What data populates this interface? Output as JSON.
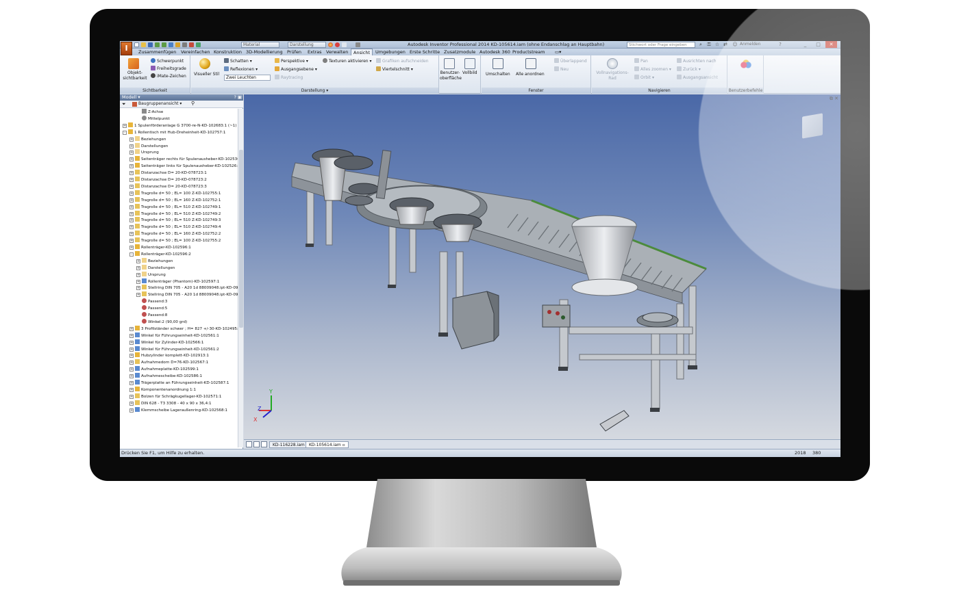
{
  "window": {
    "title": "Autodesk Inventor Professional 2014   KD-105614.iam (ohne Endanschlag an Hauptbahn)",
    "app_letter": "I",
    "search_placeholder": "Stichwort oder Frage eingeben",
    "signin": "Anmelden"
  },
  "quick_access": {
    "material": "Material",
    "appearance": "Darstellung"
  },
  "tabs": [
    "Zusammenfügen",
    "Vereinfachen",
    "Konstruktion",
    "3D-Modellierung",
    "Prüfen",
    "Extras",
    "Verwalten",
    "Ansicht",
    "Umgebungen",
    "Erste Schritte",
    "Zusatzmodule",
    "Autodesk 360",
    "Productstream"
  ],
  "active_tab": "Ansicht",
  "ribbon": {
    "sichtbarkeit": {
      "title": "Sichtbarkeit",
      "big": "Objekt-\nsichtbarkeit",
      "items": [
        "Schwerpunkt",
        "Freiheitsgrade",
        "iMate-Zeichen"
      ]
    },
    "darstellung": {
      "title": "Darstellung",
      "visual_style": "Visueller Stil",
      "items_a": [
        "Schatten",
        "Reflexionen"
      ],
      "lighting": "Zwei Leuchten",
      "items_b": [
        "Perspektive",
        "Ausgangsebene",
        "Raytracing"
      ],
      "items_c": [
        "Texturen aktivieren"
      ],
      "items_d": [
        "Grafiken aufschneiden",
        "Viertelschnitt"
      ]
    },
    "benutzer": {
      "ui": "Benutzer-\noberfläche",
      "full": "Vollbild"
    },
    "fenster": {
      "title": "Fenster",
      "switch": "Umschalten",
      "arrange": "Alle anordnen",
      "items": [
        "Überlappend",
        "Neu"
      ]
    },
    "navigieren": {
      "title": "Navigieren",
      "wheel": "Vollnavigations-\nRad",
      "items_a": [
        "Pan",
        "Alles zoomen",
        "Orbit"
      ],
      "items_b": [
        "Ausrichten nach",
        "Zurück",
        "Ausgangsansicht"
      ]
    },
    "benutzerbefehle": {
      "title": "Benutzerbefehle"
    }
  },
  "browser": {
    "title": "Modell",
    "view": "Baugruppenansicht",
    "rows": [
      {
        "i": 2,
        "t": "Z-Achse",
        "ic": "axis"
      },
      {
        "i": 2,
        "t": "Mittelpunkt",
        "ic": "point"
      },
      {
        "i": 0,
        "t": "1 Spulenförderanlage G 3700-re-N-KD-102683:1 (~1)",
        "ic": "asm",
        "x": "+"
      },
      {
        "i": 0,
        "t": "1 Rollentisch mit Hub-Dreheinheit-KD-102757:1",
        "ic": "asm",
        "x": "-"
      },
      {
        "i": 1,
        "t": "Beziehungen",
        "ic": "folder",
        "x": "+"
      },
      {
        "i": 1,
        "t": "Darstellungen",
        "ic": "folder",
        "x": "+"
      },
      {
        "i": 1,
        "t": "Ursprung",
        "ic": "folder",
        "x": "+"
      },
      {
        "i": 1,
        "t": "Seitenträger rechts für Spulenausheber-KD-102530",
        "ic": "asm",
        "x": "+"
      },
      {
        "i": 1,
        "t": "Seitenträger links für Spulenausheber-KD-102526:1",
        "ic": "asm",
        "x": "+"
      },
      {
        "i": 1,
        "t": "Distanzachse D= 20-KD-078723:1",
        "ic": "part",
        "x": "+"
      },
      {
        "i": 1,
        "t": "Distanzachse D= 20-KD-078723:2",
        "ic": "part",
        "x": "+"
      },
      {
        "i": 1,
        "t": "Distanzachse D= 20-KD-078723:3",
        "ic": "part",
        "x": "+"
      },
      {
        "i": 1,
        "t": "Tragrolle d= 50 ; EL= 100      Z-KD-102755:1",
        "ic": "part",
        "x": "+"
      },
      {
        "i": 1,
        "t": "Tragrolle d= 50 ; EL= 160      Z-KD-102752:1",
        "ic": "part",
        "x": "+"
      },
      {
        "i": 1,
        "t": "Tragrolle d= 50 ; EL= 510      Z-KD-102749:1",
        "ic": "part",
        "x": "+"
      },
      {
        "i": 1,
        "t": "Tragrolle d= 50 ; EL= 510      Z-KD-102749:2",
        "ic": "part",
        "x": "+"
      },
      {
        "i": 1,
        "t": "Tragrolle d= 50 ; EL= 510      Z-KD-102749:3",
        "ic": "part",
        "x": "+"
      },
      {
        "i": 1,
        "t": "Tragrolle d= 50 ; EL= 510      Z-KD-102749:4",
        "ic": "part",
        "x": "+"
      },
      {
        "i": 1,
        "t": "Tragrolle d= 50 ; EL= 160      Z-KD-102752:2",
        "ic": "part",
        "x": "+"
      },
      {
        "i": 1,
        "t": "Tragrolle d= 50 ; EL= 100      Z-KD-102755:2",
        "ic": "part",
        "x": "+"
      },
      {
        "i": 1,
        "t": "Rollenträger-KD-102596:1",
        "ic": "asm",
        "x": "+"
      },
      {
        "i": 1,
        "t": "Rollenträger-KD-102596:2",
        "ic": "asm",
        "x": "-"
      },
      {
        "i": 2,
        "t": "Beziehungen",
        "ic": "folder",
        "x": "+"
      },
      {
        "i": 2,
        "t": "Darstellungen",
        "ic": "folder",
        "x": "+"
      },
      {
        "i": 2,
        "t": "Ursprung",
        "ic": "folder",
        "x": "+"
      },
      {
        "i": 2,
        "t": "Rollenträger (Phantom)-KD-102597:1",
        "ic": "phantom",
        "x": "+"
      },
      {
        "i": 2,
        "t": "Stellring DIN 705 - A20 1d 88009048.ipt-KD-096",
        "ic": "part",
        "x": "+"
      },
      {
        "i": 2,
        "t": "Stellring DIN 705 - A20 1d 88009048.ipt-KD-096",
        "ic": "part",
        "x": "+"
      },
      {
        "i": 2,
        "t": "Passend:3",
        "ic": "constraint"
      },
      {
        "i": 2,
        "t": "Passend:5",
        "ic": "constraint"
      },
      {
        "i": 2,
        "t": "Passend:8",
        "ic": "constraint"
      },
      {
        "i": 2,
        "t": "Winkel:2 (90,00 grd)",
        "ic": "constraint"
      },
      {
        "i": 1,
        "t": "3 Profilständer schwer ; H= 827 +/-30-KD-102495:",
        "ic": "asm",
        "x": "+"
      },
      {
        "i": 1,
        "t": "Winkel für Führungseinheit-KD-102561:1",
        "ic": "phantom",
        "x": "+"
      },
      {
        "i": 1,
        "t": "Winkel für Zylinder-KD-102566:1",
        "ic": "phantom",
        "x": "+"
      },
      {
        "i": 1,
        "t": "Winkel für Führungseinheit-KD-102561:2",
        "ic": "phantom",
        "x": "+"
      },
      {
        "i": 1,
        "t": "Hubzylinder komplett-KD-102913:1",
        "ic": "asm",
        "x": "+"
      },
      {
        "i": 1,
        "t": "Aufnahmedorn D=76-KD-102567:1",
        "ic": "part",
        "x": "+"
      },
      {
        "i": 1,
        "t": "Aufnahmeplatte-KD-102599:1",
        "ic": "phantom",
        "x": "+"
      },
      {
        "i": 1,
        "t": "Aufnahmescheibe-KD-102586:1",
        "ic": "phantom",
        "x": "+"
      },
      {
        "i": 1,
        "t": "Trägerplatte an Führungseinheit-KD-102587:1",
        "ic": "phantom",
        "x": "+"
      },
      {
        "i": 1,
        "t": "Komponentenanordnung 1:1",
        "ic": "asm",
        "x": "+"
      },
      {
        "i": 1,
        "t": "Bolzen für Schrägkugellager-KD-102571:1",
        "ic": "part",
        "x": "+"
      },
      {
        "i": 1,
        "t": "DIN 628 - T3 3308 - 40 x 90 x 36,4:1",
        "ic": "part",
        "x": "+"
      },
      {
        "i": 1,
        "t": "Klemmscheibe Lageraußenring-KD-102568:1",
        "ic": "phantom",
        "x": "+"
      }
    ]
  },
  "axes": {
    "x": "X",
    "y": "Y",
    "z": "Z"
  },
  "doc_tabs": [
    "KD-116228.iam",
    "KD-105614.iam"
  ],
  "active_doc": "KD-105614.iam",
  "status": {
    "hint": "Drücken Sie F1, um Hilfe zu erhalten.",
    "n1": "2018",
    "n2": "380"
  }
}
